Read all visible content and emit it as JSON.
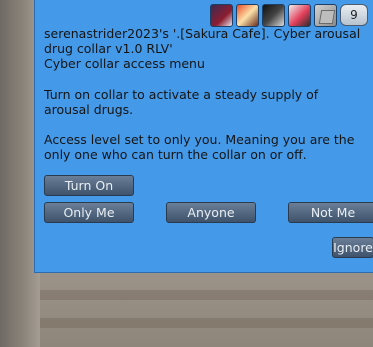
{
  "dialog": {
    "notification_count": "9",
    "lines": [
      "serenastrider2023's '.[Sakura Cafe]. Cyber arousal drug collar v1.0 RLV'",
      "Cyber collar access menu",
      "",
      "Turn on collar to activate a steady supply of arousal drugs.",
      "",
      "Access level set to only you. Meaning you are the only one who can turn the collar on or off."
    ],
    "buttons": {
      "turn_on": "Turn On",
      "only_me": "Only Me",
      "anyone": "Anyone",
      "not_me": "Not Me",
      "ignore": "Ignore"
    }
  },
  "colors": {
    "dialog_bg": "#4499e8",
    "button_bg": "#4e637b",
    "text": "#151515"
  },
  "icons": [
    "avatar-icon-1",
    "avatar-icon-2",
    "avatar-icon-3",
    "avatar-icon-4",
    "object-cube-icon"
  ]
}
